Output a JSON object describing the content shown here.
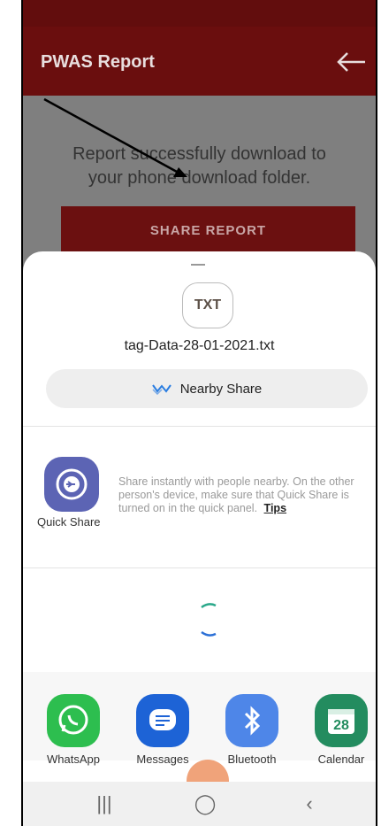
{
  "appbar": {
    "title": "PWAS Report",
    "back_icon": "arrow-left-icon"
  },
  "content": {
    "message_line1": "Report successfully download to",
    "message_line2": "your phone download folder.",
    "share_button": "SHARE REPORT"
  },
  "sheet": {
    "file_type": "TXT",
    "file_name": "tag-Data-28-01-2021.txt",
    "nearby_share": "Nearby Share",
    "quick_share": {
      "label": "Quick Share",
      "description": "Share instantly with people nearby. On the other person's device, make sure that Quick Share is turned on in the quick panel.",
      "tips": "Tips"
    },
    "apps": [
      {
        "name": "WhatsApp",
        "icon": "whatsapp-icon",
        "color": "#2dbe4f"
      },
      {
        "name": "Messages",
        "icon": "messages-icon",
        "color": "#1d63d6"
      },
      {
        "name": "Bluetooth",
        "icon": "bluetooth-icon",
        "color": "#4e86e8"
      },
      {
        "name": "Calendar",
        "icon": "calendar-icon",
        "color": "#238c5f",
        "day": "28"
      }
    ]
  },
  "colors": {
    "appbar": "#6a0e0e",
    "accent": "#6b1010"
  }
}
